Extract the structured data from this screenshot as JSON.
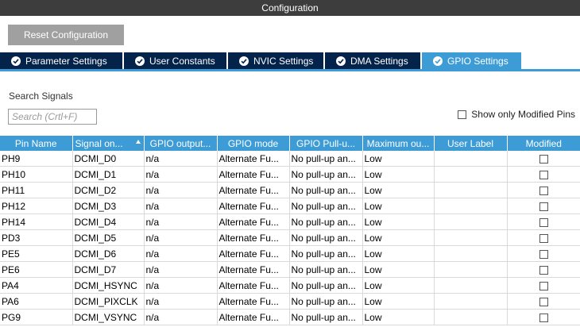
{
  "window": {
    "title": "Configuration"
  },
  "reset_label": "Reset Configuration",
  "tabs": [
    {
      "label": "Parameter Settings",
      "active": false
    },
    {
      "label": "User Constants",
      "active": false
    },
    {
      "label": "NVIC Settings",
      "active": false
    },
    {
      "label": "DMA Settings",
      "active": false
    },
    {
      "label": "GPIO Settings",
      "active": true
    }
  ],
  "search": {
    "label": "Search Signals",
    "placeholder": "Search (Crtl+F)",
    "value": ""
  },
  "filter": {
    "show_modified_label": "Show only Modified Pins",
    "checked": false
  },
  "table": {
    "headers": [
      "Pin Name",
      "Signal on...",
      "GPIO output...",
      "GPIO mode",
      "GPIO Pull-u...",
      "Maximum ou...",
      "User Label",
      "Modified"
    ],
    "rows": [
      [
        "PH9",
        "DCMI_D0",
        "n/a",
        "Alternate Fu...",
        "No pull-up an...",
        "Low",
        "",
        false
      ],
      [
        "PH10",
        "DCMI_D1",
        "n/a",
        "Alternate Fu...",
        "No pull-up an...",
        "Low",
        "",
        false
      ],
      [
        "PH11",
        "DCMI_D2",
        "n/a",
        "Alternate Fu...",
        "No pull-up an...",
        "Low",
        "",
        false
      ],
      [
        "PH12",
        "DCMI_D3",
        "n/a",
        "Alternate Fu...",
        "No pull-up an...",
        "Low",
        "",
        false
      ],
      [
        "PH14",
        "DCMI_D4",
        "n/a",
        "Alternate Fu...",
        "No pull-up an...",
        "Low",
        "",
        false
      ],
      [
        "PD3",
        "DCMI_D5",
        "n/a",
        "Alternate Fu...",
        "No pull-up an...",
        "Low",
        "",
        false
      ],
      [
        "PE5",
        "DCMI_D6",
        "n/a",
        "Alternate Fu...",
        "No pull-up an...",
        "Low",
        "",
        false
      ],
      [
        "PE6",
        "DCMI_D7",
        "n/a",
        "Alternate Fu...",
        "No pull-up an...",
        "Low",
        "",
        false
      ],
      [
        "PA4",
        "DCMI_HSYNC",
        "n/a",
        "Alternate Fu...",
        "No pull-up an...",
        "Low",
        "",
        false
      ],
      [
        "PA6",
        "DCMI_PIXCLK",
        "n/a",
        "Alternate Fu...",
        "No pull-up an...",
        "Low",
        "",
        false
      ],
      [
        "PG9",
        "DCMI_VSYNC",
        "n/a",
        "Alternate Fu...",
        "No pull-up an...",
        "Low",
        "",
        false
      ]
    ]
  },
  "colors": {
    "accent": "#3d9bd5",
    "tab_dark": "#03234b",
    "titlebar": "#3d3d3d",
    "button": "#a0a0a0"
  }
}
